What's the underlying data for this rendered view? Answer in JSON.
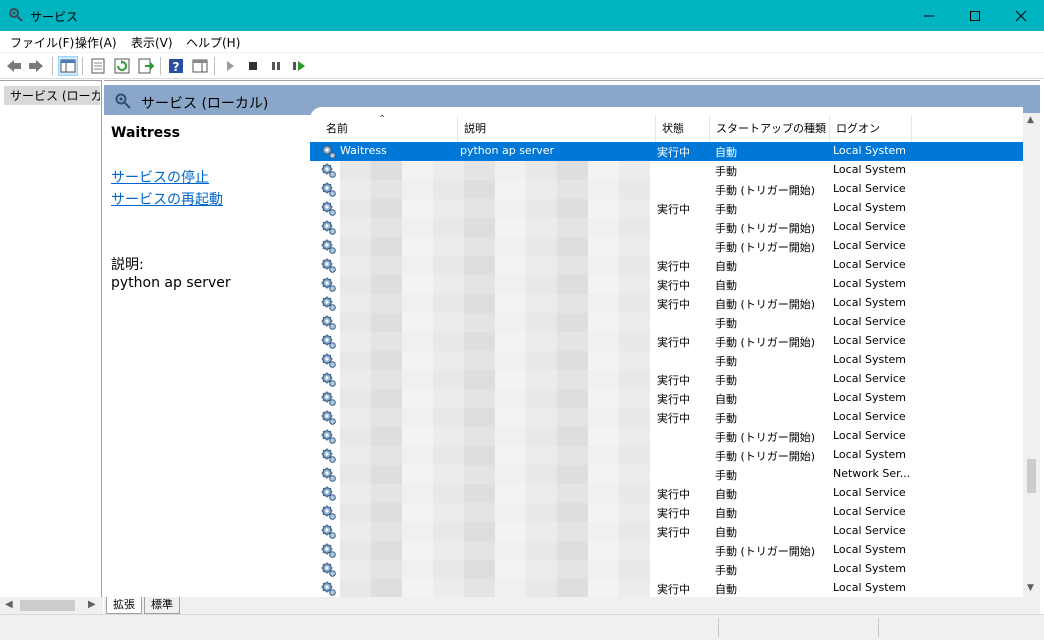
{
  "window": {
    "title": "サービス"
  },
  "menu": {
    "items": [
      "ファイル(F)",
      "操作(A)",
      "表示(V)",
      "ヘルプ(H)"
    ]
  },
  "tree": {
    "item": "サービス (ローカル)"
  },
  "panel": {
    "header": "サービス (ローカル)",
    "service_name": "Waitress",
    "stop_link": "サービスの停止",
    "restart_link": "サービスの再起動",
    "desc_label": "説明:",
    "desc_text": "python ap server"
  },
  "table": {
    "columns": [
      "名前",
      "説明",
      "状態",
      "スタートアップの種類",
      "ログオン"
    ],
    "rows": [
      {
        "name": "Waitress",
        "desc": "python ap server",
        "status": "実行中",
        "startup": "自動",
        "logon": "Local System",
        "selected": true
      },
      {
        "name": "",
        "desc": "",
        "status": "",
        "startup": "手動",
        "logon": "Local System"
      },
      {
        "name": "",
        "desc": "",
        "status": "",
        "startup": "手動 (トリガー開始)",
        "logon": "Local Service"
      },
      {
        "name": "",
        "desc": "",
        "status": "実行中",
        "startup": "手動",
        "logon": "Local System"
      },
      {
        "name": "",
        "desc": "",
        "status": "",
        "startup": "手動 (トリガー開始)",
        "logon": "Local Service"
      },
      {
        "name": "",
        "desc": "",
        "status": "",
        "startup": "手動 (トリガー開始)",
        "logon": "Local Service"
      },
      {
        "name": "",
        "desc": "",
        "status": "実行中",
        "startup": "自動",
        "logon": "Local Service"
      },
      {
        "name": "",
        "desc": "",
        "status": "実行中",
        "startup": "自動",
        "logon": "Local System"
      },
      {
        "name": "",
        "desc": "",
        "status": "実行中",
        "startup": "自動 (トリガー開始)",
        "logon": "Local System"
      },
      {
        "name": "",
        "desc": "",
        "status": "",
        "startup": "手動",
        "logon": "Local Service"
      },
      {
        "name": "",
        "desc": "",
        "status": "実行中",
        "startup": "手動 (トリガー開始)",
        "logon": "Local Service"
      },
      {
        "name": "",
        "desc": "",
        "status": "",
        "startup": "手動",
        "logon": "Local System"
      },
      {
        "name": "",
        "desc": "",
        "status": "実行中",
        "startup": "手動",
        "logon": "Local Service"
      },
      {
        "name": "",
        "desc": "",
        "status": "実行中",
        "startup": "自動",
        "logon": "Local System"
      },
      {
        "name": "",
        "desc": "",
        "status": "実行中",
        "startup": "手動",
        "logon": "Local Service"
      },
      {
        "name": "",
        "desc": "",
        "status": "",
        "startup": "手動 (トリガー開始)",
        "logon": "Local Service"
      },
      {
        "name": "",
        "desc": "",
        "status": "",
        "startup": "手動 (トリガー開始)",
        "logon": "Local System"
      },
      {
        "name": "",
        "desc": "",
        "status": "",
        "startup": "手動",
        "logon": "Network Ser..."
      },
      {
        "name": "",
        "desc": "",
        "status": "実行中",
        "startup": "自動",
        "logon": "Local Service"
      },
      {
        "name": "",
        "desc": "",
        "status": "実行中",
        "startup": "自動",
        "logon": "Local Service"
      },
      {
        "name": "",
        "desc": "",
        "status": "実行中",
        "startup": "自動",
        "logon": "Local Service"
      },
      {
        "name": "",
        "desc": "",
        "status": "",
        "startup": "手動 (トリガー開始)",
        "logon": "Local System"
      },
      {
        "name": "",
        "desc": "",
        "status": "",
        "startup": "手動",
        "logon": "Local System"
      },
      {
        "name": "",
        "desc": "",
        "status": "実行中",
        "startup": "自動",
        "logon": "Local System"
      }
    ]
  },
  "tabs": [
    "拡張",
    "標準"
  ],
  "colors": {
    "titlebar": "#00b4c0",
    "selection": "#0078d7",
    "header_band": "#8aa6c8",
    "link": "#0066cc"
  }
}
